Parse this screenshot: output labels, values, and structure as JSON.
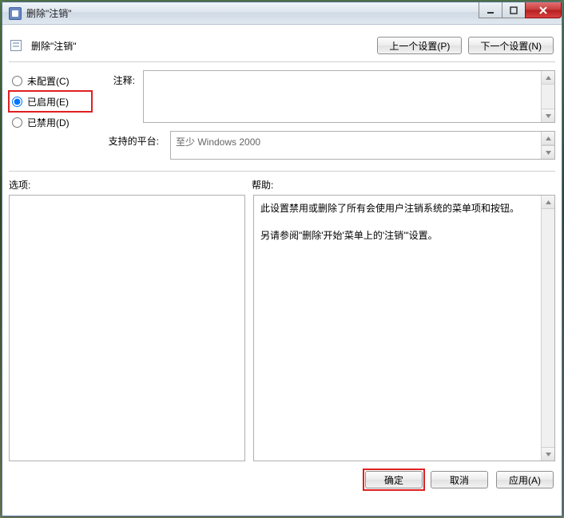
{
  "window": {
    "title": "删除\"注销\""
  },
  "header": {
    "policy_title": "删除\"注销\"",
    "prev_btn": "上一个设置(P)",
    "next_btn": "下一个设置(N)"
  },
  "radios": {
    "not_configured": "未配置(C)",
    "enabled": "已启用(E)",
    "disabled": "已禁用(D)",
    "selected": "enabled"
  },
  "labels": {
    "comment": "注释:",
    "supported": "支持的平台:",
    "options": "选项:",
    "help": "帮助:"
  },
  "platform_text": "至少 Windows 2000",
  "comment_text": "",
  "help_text": {
    "line1": "此设置禁用或删除了所有会使用户注销系统的菜单项和按钮。",
    "line2": "另请参阅\"删除'开始'菜单上的'注销'\"设置。"
  },
  "footer": {
    "ok": "确定",
    "cancel": "取消",
    "apply": "应用(A)"
  }
}
